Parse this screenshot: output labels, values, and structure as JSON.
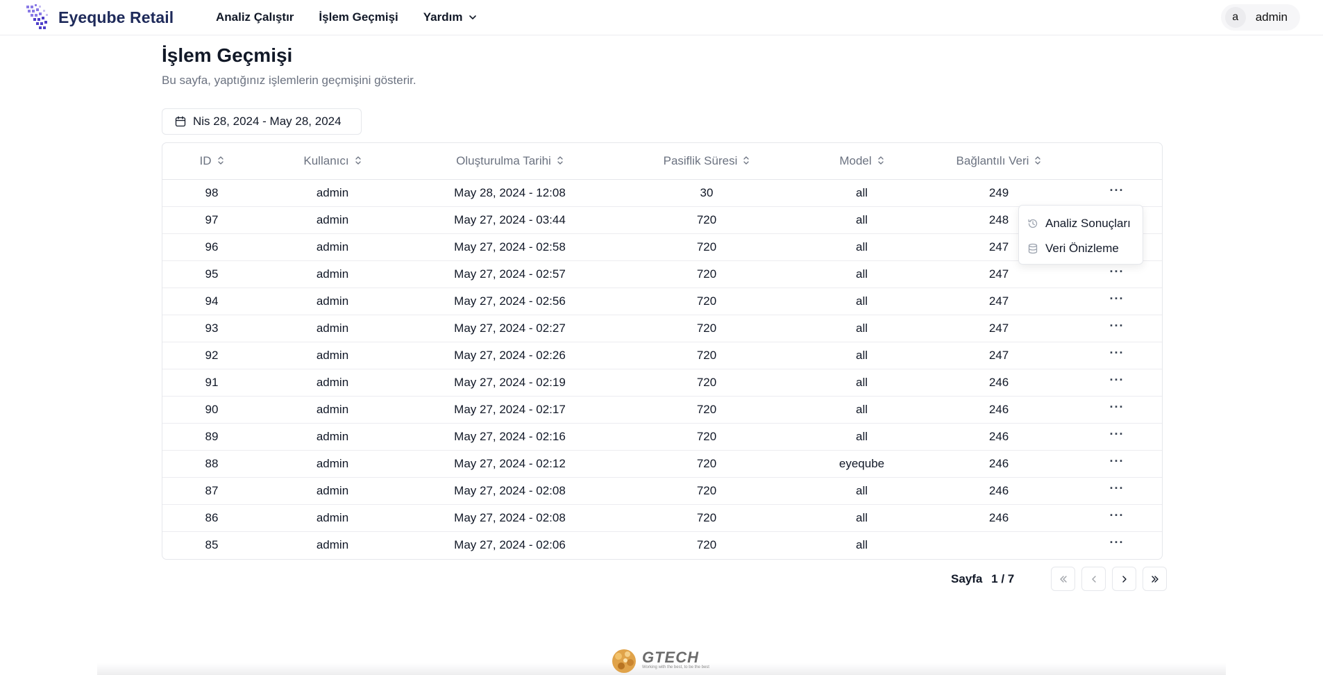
{
  "app": {
    "name": "Eyeqube Retail"
  },
  "nav": {
    "items": [
      {
        "label": "Analiz Çalıştır"
      },
      {
        "label": "İşlem Geçmişi"
      },
      {
        "label": "Yardım"
      }
    ]
  },
  "user": {
    "initial": "a",
    "name": "admin"
  },
  "page": {
    "title": "İşlem Geçmişi",
    "subtitle": "Bu sayfa, yaptığınız işlemlerin geçmişini gösterir."
  },
  "date_range": {
    "label": "Nis 28, 2024 - May 28, 2024"
  },
  "table": {
    "columns": [
      "ID",
      "Kullanıcı",
      "Oluşturulma Tarihi",
      "Pasiflik Süresi",
      "Model",
      "Bağlantılı Veri"
    ],
    "rows": [
      {
        "id": "98",
        "user": "admin",
        "created": "May 28, 2024 - 12:08",
        "passive": "30",
        "model": "all",
        "linked": "249"
      },
      {
        "id": "97",
        "user": "admin",
        "created": "May 27, 2024 - 03:44",
        "passive": "720",
        "model": "all",
        "linked": "248"
      },
      {
        "id": "96",
        "user": "admin",
        "created": "May 27, 2024 - 02:58",
        "passive": "720",
        "model": "all",
        "linked": "247"
      },
      {
        "id": "95",
        "user": "admin",
        "created": "May 27, 2024 - 02:57",
        "passive": "720",
        "model": "all",
        "linked": "247"
      },
      {
        "id": "94",
        "user": "admin",
        "created": "May 27, 2024 - 02:56",
        "passive": "720",
        "model": "all",
        "linked": "247"
      },
      {
        "id": "93",
        "user": "admin",
        "created": "May 27, 2024 - 02:27",
        "passive": "720",
        "model": "all",
        "linked": "247"
      },
      {
        "id": "92",
        "user": "admin",
        "created": "May 27, 2024 - 02:26",
        "passive": "720",
        "model": "all",
        "linked": "247"
      },
      {
        "id": "91",
        "user": "admin",
        "created": "May 27, 2024 - 02:19",
        "passive": "720",
        "model": "all",
        "linked": "246"
      },
      {
        "id": "90",
        "user": "admin",
        "created": "May 27, 2024 - 02:17",
        "passive": "720",
        "model": "all",
        "linked": "246"
      },
      {
        "id": "89",
        "user": "admin",
        "created": "May 27, 2024 - 02:16",
        "passive": "720",
        "model": "all",
        "linked": "246"
      },
      {
        "id": "88",
        "user": "admin",
        "created": "May 27, 2024 - 02:12",
        "passive": "720",
        "model": "eyeqube",
        "linked": "246"
      },
      {
        "id": "87",
        "user": "admin",
        "created": "May 27, 2024 - 02:08",
        "passive": "720",
        "model": "all",
        "linked": "246"
      },
      {
        "id": "86",
        "user": "admin",
        "created": "May 27, 2024 - 02:08",
        "passive": "720",
        "model": "all",
        "linked": "246"
      },
      {
        "id": "85",
        "user": "admin",
        "created": "May 27, 2024 - 02:06",
        "passive": "720",
        "model": "all",
        "linked": ""
      }
    ]
  },
  "row_menu": {
    "items": [
      {
        "label": "Analiz Sonuçları",
        "icon": "history-icon"
      },
      {
        "label": "Veri Önizleme",
        "icon": "database-icon"
      }
    ]
  },
  "pagination": {
    "label": "Sayfa",
    "current": "1",
    "total": "/ 7"
  },
  "footer": {
    "brand": "GTECH",
    "tagline": "Working with the best, to be the best"
  },
  "colors": {
    "brand": "#1e2a5a",
    "accent": "#6d4fd8",
    "muted": "#6b7280",
    "border": "#e5e7eb"
  }
}
